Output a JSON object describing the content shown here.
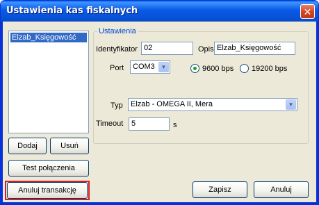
{
  "window": {
    "title": "Ustawienia kas fiskalnych",
    "close_glyph": "✕"
  },
  "device_list": {
    "items": [
      "Elzab_Księgowość"
    ],
    "selected_index": 0
  },
  "buttons": {
    "add": "Dodaj",
    "remove": "Usuń",
    "test_connection": "Test połączenia",
    "cancel_transaction": "Anuluj transakcję",
    "save": "Zapisz",
    "cancel": "Anuluj"
  },
  "settings": {
    "group_title": "Ustawienia",
    "identifier_label": "Identyfikator",
    "identifier_value": "02",
    "description_label": "Opis",
    "description_value": "Elzab_Księgowość",
    "port_label": "Port",
    "port_value": "COM3",
    "baud_options": [
      "9600 bps",
      "19200 bps"
    ],
    "baud_selected": "9600 bps",
    "type_label": "Typ",
    "type_value": "Elzab - OMEGA II, Mera",
    "timeout_label": "Timeout",
    "timeout_value": "5",
    "timeout_unit": "s"
  },
  "colors": {
    "titlebar": "#0a5ae6",
    "selection": "#316ac5",
    "highlight_border": "#e01b1b",
    "group_title": "#0046d5"
  }
}
